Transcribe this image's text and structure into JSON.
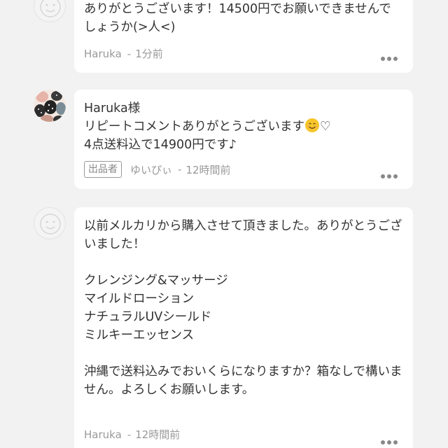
{
  "comments": [
    {
      "author": "Haruka",
      "text": "ありがとうございます！14500円でお願いできませんでしょうか(>人<)",
      "time": "1分前",
      "avatar": "default-avatar-icon"
    },
    {
      "author": "ゆいぴぃ",
      "badge": "出品者",
      "text_line1": "Haruka様",
      "text_line2": "リピートコメントありがとうございます",
      "text_heart": "♡",
      "text_line3": "4点送料込で14900円です♪",
      "time": "12時間前",
      "avatar": "patterned-avatar-icon"
    },
    {
      "author": "Haruka",
      "text": "以前メルカリから購入させて頂きました。ありがとうございました！\n\nクレンジング&マッサージ\nマイルドローション\nナチュラルUVシールド\nミルキーエッセンス\n\n沖縄で送料込みでおいくらになりますか？箱なしで構いません。よろしくお願いします。",
      "time": "12時間前",
      "avatar": "default-avatar-icon"
    }
  ],
  "separator": "-",
  "colors": {
    "background": "#f2f2f2",
    "bubble": "#ffffff",
    "text": "#333333",
    "meta": "#999999"
  }
}
